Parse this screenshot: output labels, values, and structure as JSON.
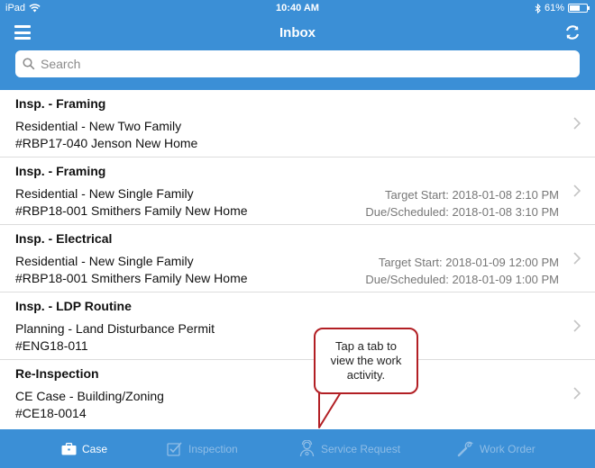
{
  "status_bar": {
    "carrier": "iPad",
    "time": "10:40 AM",
    "battery": "61%",
    "battery_level": 0.61
  },
  "header": {
    "title": "Inbox",
    "menu_icon": "hamburger-menu-icon",
    "refresh_icon": "refresh-icon"
  },
  "search": {
    "placeholder": "Search",
    "value": ""
  },
  "items": [
    {
      "title": "Insp. - Framing",
      "line1": "Residential - New Two Family",
      "line2": "#RBP17-040 Jenson New Home",
      "right1": "",
      "right2": ""
    },
    {
      "title": "Insp. - Framing",
      "line1": "Residential - New Single Family",
      "line2": "#RBP18-001 Smithers Family New Home",
      "right1": "Target Start: 2018-01-08 2:10 PM",
      "right2": "Due/Scheduled: 2018-01-08 3:10 PM"
    },
    {
      "title": "Insp. - Electrical",
      "line1": "Residential - New Single Family",
      "line2": "#RBP18-001 Smithers Family New Home",
      "right1": "Target Start: 2018-01-09 12:00 PM",
      "right2": "Due/Scheduled: 2018-01-09 1:00 PM"
    },
    {
      "title": "Insp. - LDP Routine",
      "line1": "Planning - Land Disturbance Permit",
      "line2": "#ENG18-011",
      "right1": "",
      "right2": ""
    },
    {
      "title": "Re-Inspection",
      "line1": "CE Case - Building/Zoning",
      "line2": "#CE18-0014",
      "right1": "",
      "right2": ""
    }
  ],
  "tooltip": {
    "line1": "Tap a tab to",
    "line2": "view the work",
    "line3": "activity."
  },
  "tabs": [
    {
      "label": "Case",
      "icon": "briefcase-icon",
      "active": true
    },
    {
      "label": "Inspection",
      "icon": "checklist-icon",
      "active": false
    },
    {
      "label": "Service Request",
      "icon": "service-person-icon",
      "active": false
    },
    {
      "label": "Work Order",
      "icon": "wrench-icon",
      "active": false
    }
  ],
  "colors": {
    "brand_blue": "#3b8fd6",
    "tooltip_border": "#b21f24",
    "inactive_tab": "#8fbde6"
  }
}
